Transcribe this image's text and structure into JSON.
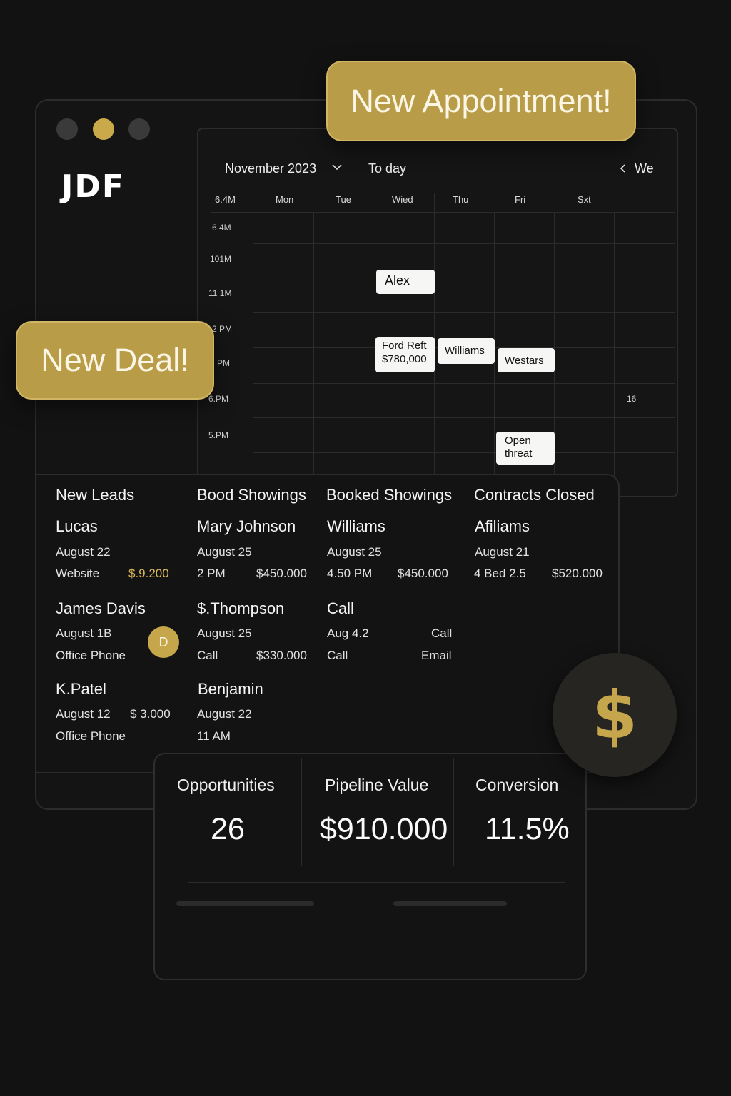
{
  "colors": {
    "gold": "#b99c47",
    "background": "#121212",
    "dot_dark": "#3a3a3a"
  },
  "brand": {
    "logo": "JDF"
  },
  "window_controls": [
    "dot-dark",
    "dot-gold",
    "dot-dark"
  ],
  "toasts": {
    "appointment": "New Appointment!",
    "deal": "New Deal!"
  },
  "calendar": {
    "month": "November 2023",
    "today": "To day",
    "view": "We",
    "corner_label": "6.4M",
    "days": [
      "Mon",
      "Tue",
      "Wied",
      "Thu",
      "Fri",
      "Sxt"
    ],
    "times": [
      "6.4M",
      "101M",
      "11 1M",
      "2 PM",
      "PM",
      "6.PM",
      "5.PM"
    ],
    "day_number": "16",
    "events": {
      "alex": "Alex",
      "ford": [
        "Ford Reft",
        "$780,000"
      ],
      "williams": "Williams",
      "westars": "Westars",
      "open_threat": [
        "Open",
        "threat"
      ]
    }
  },
  "pipeline": {
    "columns": [
      {
        "title": "New Leads",
        "cards": [
          {
            "name": "Lucas",
            "date": "August 22",
            "source": "Website",
            "amount": "$.9.200"
          },
          {
            "name": "James Davis",
            "date": "August 1B",
            "source": "Office Phone",
            "avatar": "D"
          },
          {
            "name": "K.Patel",
            "date": "August 12",
            "amount": "$ 3.000",
            "source": "Office Phone"
          }
        ]
      },
      {
        "title": "Bood Showings",
        "cards": [
          {
            "name": "Mary Johnson",
            "date": "August 25",
            "time": "2 PM",
            "amount": "$450.000"
          },
          {
            "name": "$.Thompson",
            "date": "August 25",
            "time": "Call",
            "amount": "$330.000"
          },
          {
            "name": "Benjamin",
            "date": "August 22",
            "time": "11 AM"
          }
        ]
      },
      {
        "title": "Booked Showings",
        "cards": [
          {
            "name": "Williams",
            "date": "August 25",
            "time": "4.50 PM",
            "amount": "$450.000"
          },
          {
            "name": "Call",
            "date": "Aug 4.2",
            "date_right": "Call",
            "time": "Call",
            "time_right": "Email"
          }
        ]
      },
      {
        "title": "Contracts Closed",
        "cards": [
          {
            "name": "Afiliams",
            "date": "August 21",
            "details": "4 Bed  2.5",
            "amount": "$520.000"
          }
        ]
      }
    ]
  },
  "stats": [
    {
      "label": "Opportunities",
      "value": "26"
    },
    {
      "label": "Pipeline Value",
      "value": "$910.000"
    },
    {
      "label": "Conversion",
      "value": "11.5%"
    }
  ],
  "coin": {
    "symbol": "$",
    "icon": "dollar-icon"
  }
}
